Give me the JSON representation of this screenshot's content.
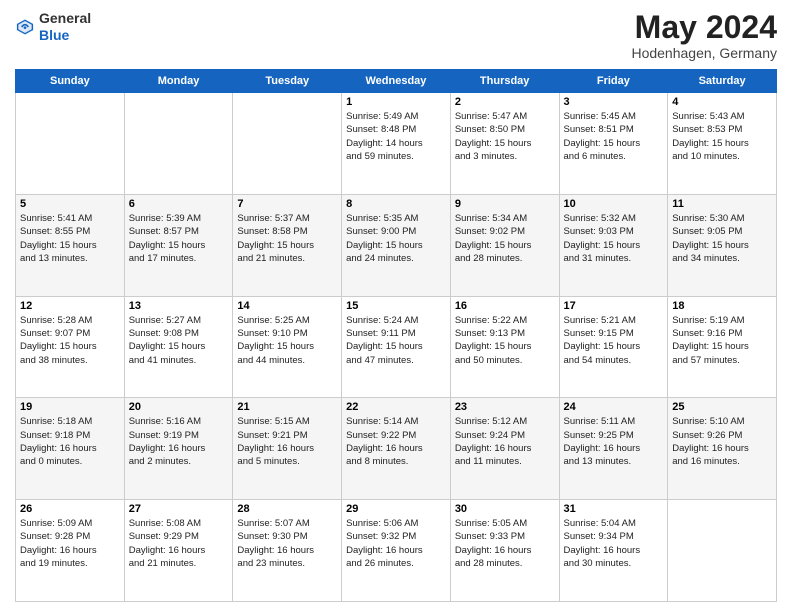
{
  "logo": {
    "general": "General",
    "blue": "Blue"
  },
  "header": {
    "month": "May 2024",
    "location": "Hodenhagen, Germany"
  },
  "days_of_week": [
    "Sunday",
    "Monday",
    "Tuesday",
    "Wednesday",
    "Thursday",
    "Friday",
    "Saturday"
  ],
  "weeks": [
    [
      {
        "day": "",
        "info": ""
      },
      {
        "day": "",
        "info": ""
      },
      {
        "day": "",
        "info": ""
      },
      {
        "day": "1",
        "info": "Sunrise: 5:49 AM\nSunset: 8:48 PM\nDaylight: 14 hours\nand 59 minutes."
      },
      {
        "day": "2",
        "info": "Sunrise: 5:47 AM\nSunset: 8:50 PM\nDaylight: 15 hours\nand 3 minutes."
      },
      {
        "day": "3",
        "info": "Sunrise: 5:45 AM\nSunset: 8:51 PM\nDaylight: 15 hours\nand 6 minutes."
      },
      {
        "day": "4",
        "info": "Sunrise: 5:43 AM\nSunset: 8:53 PM\nDaylight: 15 hours\nand 10 minutes."
      }
    ],
    [
      {
        "day": "5",
        "info": "Sunrise: 5:41 AM\nSunset: 8:55 PM\nDaylight: 15 hours\nand 13 minutes."
      },
      {
        "day": "6",
        "info": "Sunrise: 5:39 AM\nSunset: 8:57 PM\nDaylight: 15 hours\nand 17 minutes."
      },
      {
        "day": "7",
        "info": "Sunrise: 5:37 AM\nSunset: 8:58 PM\nDaylight: 15 hours\nand 21 minutes."
      },
      {
        "day": "8",
        "info": "Sunrise: 5:35 AM\nSunset: 9:00 PM\nDaylight: 15 hours\nand 24 minutes."
      },
      {
        "day": "9",
        "info": "Sunrise: 5:34 AM\nSunset: 9:02 PM\nDaylight: 15 hours\nand 28 minutes."
      },
      {
        "day": "10",
        "info": "Sunrise: 5:32 AM\nSunset: 9:03 PM\nDaylight: 15 hours\nand 31 minutes."
      },
      {
        "day": "11",
        "info": "Sunrise: 5:30 AM\nSunset: 9:05 PM\nDaylight: 15 hours\nand 34 minutes."
      }
    ],
    [
      {
        "day": "12",
        "info": "Sunrise: 5:28 AM\nSunset: 9:07 PM\nDaylight: 15 hours\nand 38 minutes."
      },
      {
        "day": "13",
        "info": "Sunrise: 5:27 AM\nSunset: 9:08 PM\nDaylight: 15 hours\nand 41 minutes."
      },
      {
        "day": "14",
        "info": "Sunrise: 5:25 AM\nSunset: 9:10 PM\nDaylight: 15 hours\nand 44 minutes."
      },
      {
        "day": "15",
        "info": "Sunrise: 5:24 AM\nSunset: 9:11 PM\nDaylight: 15 hours\nand 47 minutes."
      },
      {
        "day": "16",
        "info": "Sunrise: 5:22 AM\nSunset: 9:13 PM\nDaylight: 15 hours\nand 50 minutes."
      },
      {
        "day": "17",
        "info": "Sunrise: 5:21 AM\nSunset: 9:15 PM\nDaylight: 15 hours\nand 54 minutes."
      },
      {
        "day": "18",
        "info": "Sunrise: 5:19 AM\nSunset: 9:16 PM\nDaylight: 15 hours\nand 57 minutes."
      }
    ],
    [
      {
        "day": "19",
        "info": "Sunrise: 5:18 AM\nSunset: 9:18 PM\nDaylight: 16 hours\nand 0 minutes."
      },
      {
        "day": "20",
        "info": "Sunrise: 5:16 AM\nSunset: 9:19 PM\nDaylight: 16 hours\nand 2 minutes."
      },
      {
        "day": "21",
        "info": "Sunrise: 5:15 AM\nSunset: 9:21 PM\nDaylight: 16 hours\nand 5 minutes."
      },
      {
        "day": "22",
        "info": "Sunrise: 5:14 AM\nSunset: 9:22 PM\nDaylight: 16 hours\nand 8 minutes."
      },
      {
        "day": "23",
        "info": "Sunrise: 5:12 AM\nSunset: 9:24 PM\nDaylight: 16 hours\nand 11 minutes."
      },
      {
        "day": "24",
        "info": "Sunrise: 5:11 AM\nSunset: 9:25 PM\nDaylight: 16 hours\nand 13 minutes."
      },
      {
        "day": "25",
        "info": "Sunrise: 5:10 AM\nSunset: 9:26 PM\nDaylight: 16 hours\nand 16 minutes."
      }
    ],
    [
      {
        "day": "26",
        "info": "Sunrise: 5:09 AM\nSunset: 9:28 PM\nDaylight: 16 hours\nand 19 minutes."
      },
      {
        "day": "27",
        "info": "Sunrise: 5:08 AM\nSunset: 9:29 PM\nDaylight: 16 hours\nand 21 minutes."
      },
      {
        "day": "28",
        "info": "Sunrise: 5:07 AM\nSunset: 9:30 PM\nDaylight: 16 hours\nand 23 minutes."
      },
      {
        "day": "29",
        "info": "Sunrise: 5:06 AM\nSunset: 9:32 PM\nDaylight: 16 hours\nand 26 minutes."
      },
      {
        "day": "30",
        "info": "Sunrise: 5:05 AM\nSunset: 9:33 PM\nDaylight: 16 hours\nand 28 minutes."
      },
      {
        "day": "31",
        "info": "Sunrise: 5:04 AM\nSunset: 9:34 PM\nDaylight: 16 hours\nand 30 minutes."
      },
      {
        "day": "",
        "info": ""
      }
    ]
  ]
}
